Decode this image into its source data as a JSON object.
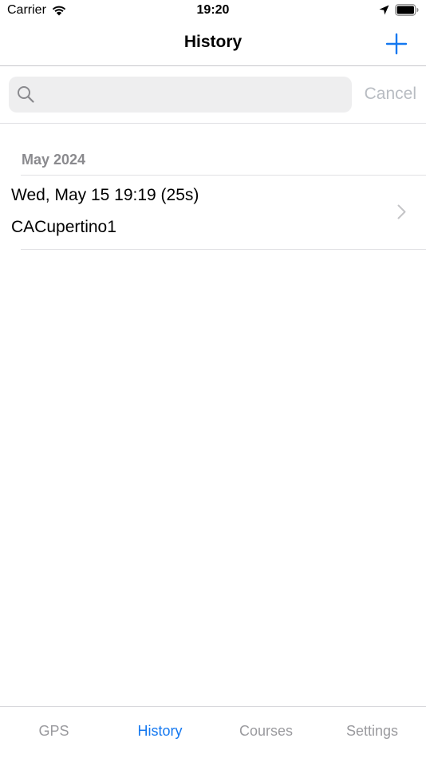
{
  "status_bar": {
    "carrier": "Carrier",
    "time": "19:20"
  },
  "nav": {
    "title": "History",
    "add_icon": "plus-icon"
  },
  "search": {
    "value": "",
    "placeholder": "",
    "cancel_label": "Cancel"
  },
  "sections": [
    {
      "header": "May 2024",
      "items": [
        {
          "title": "Wed, May 15 19:19 (25s)",
          "subtitle": "CACupertino1"
        }
      ]
    }
  ],
  "tabs": [
    {
      "label": "GPS",
      "active": false
    },
    {
      "label": "History",
      "active": true
    },
    {
      "label": "Courses",
      "active": false
    },
    {
      "label": "Settings",
      "active": false
    }
  ],
  "colors": {
    "accent": "#1478f0",
    "inactive_tab": "#9a9a9e",
    "cancel": "#b8bcc2",
    "section_header": "#8a8a8e"
  }
}
